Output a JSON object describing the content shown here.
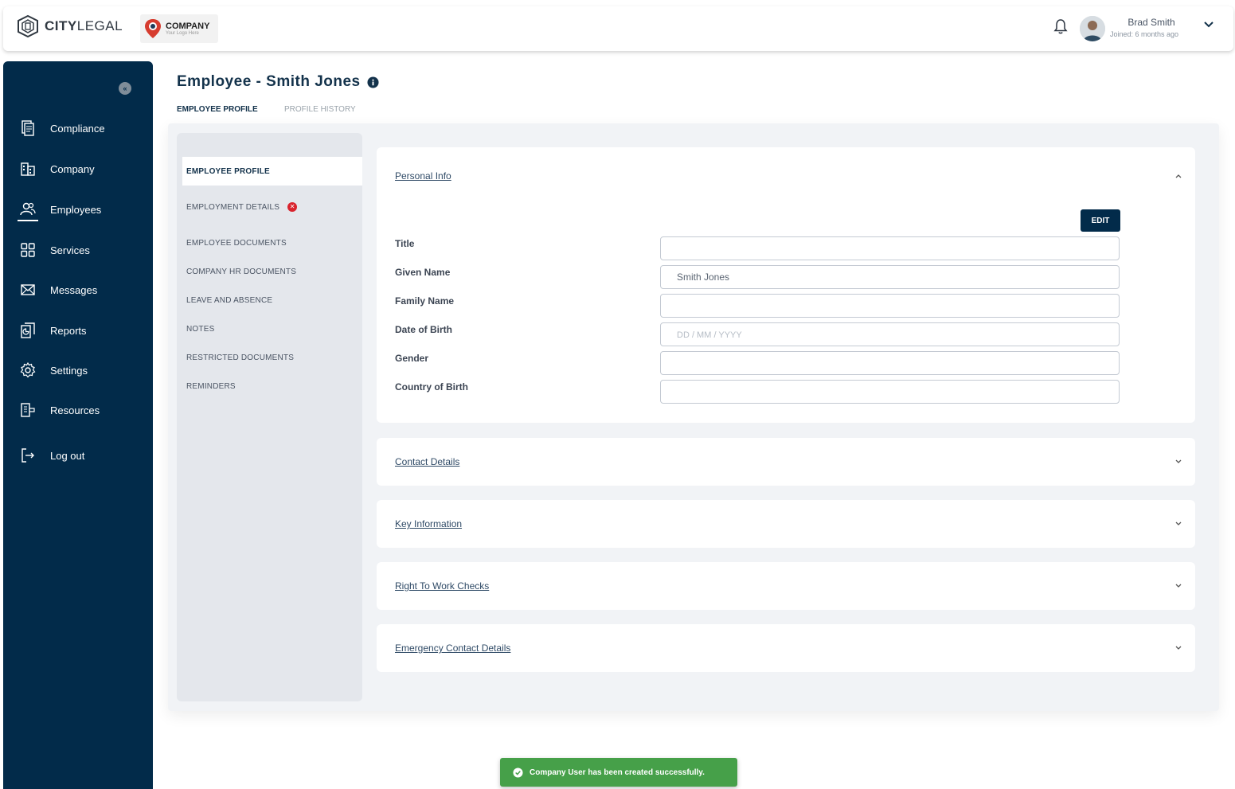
{
  "header": {
    "brand": {
      "bold": "CITY",
      "light": "LEGAL"
    },
    "company_logo": {
      "name": "COMPANY",
      "tagline": "Your Logo Here"
    },
    "user": {
      "name": "Brad Smith",
      "joined": "Joined: 6 months ago"
    }
  },
  "sidebar": {
    "collapse_label": "«",
    "items": [
      {
        "label": "Compliance",
        "icon": "compliance-icon"
      },
      {
        "label": "Company",
        "icon": "building-icon"
      },
      {
        "label": "Employees",
        "icon": "users-icon",
        "active": true
      },
      {
        "label": "Services",
        "icon": "grid-icon"
      },
      {
        "label": "Messages",
        "icon": "envelope-icon"
      },
      {
        "label": "Reports",
        "icon": "reports-icon"
      },
      {
        "label": "Settings",
        "icon": "gear-icon"
      },
      {
        "label": "Resources",
        "icon": "resources-icon"
      },
      {
        "label": "Log out",
        "icon": "logout-icon"
      }
    ]
  },
  "page": {
    "title": "Employee - Smith Jones",
    "tabs": [
      {
        "label": "EMPLOYEE PROFILE",
        "active": true
      },
      {
        "label": "PROFILE HISTORY",
        "active": false
      }
    ]
  },
  "subnav": {
    "items": [
      {
        "label": "EMPLOYEE PROFILE",
        "active": true
      },
      {
        "label": "EMPLOYMENT DETAILS",
        "error_badge": "✕"
      },
      {
        "label": "EMPLOYEE DOCUMENTS"
      },
      {
        "label": "COMPANY HR DOCUMENTS"
      },
      {
        "label": "LEAVE AND ABSENCE"
      },
      {
        "label": "NOTES"
      },
      {
        "label": "RESTRICTED DOCUMENTS"
      },
      {
        "label": "REMINDERS"
      }
    ]
  },
  "personal_info": {
    "title": "Personal Info",
    "edit_label": "EDIT",
    "fields": [
      {
        "label": "Title",
        "value": "",
        "placeholder": ""
      },
      {
        "label": "Given Name",
        "value": "Smith Jones",
        "placeholder": ""
      },
      {
        "label": "Family Name",
        "value": "",
        "placeholder": ""
      },
      {
        "label": "Date of Birth",
        "value": "",
        "placeholder": "DD / MM / YYYY"
      },
      {
        "label": "Gender",
        "value": "",
        "placeholder": ""
      },
      {
        "label": "Country of Birth",
        "value": "",
        "placeholder": ""
      }
    ]
  },
  "sections": [
    {
      "title": "Contact Details"
    },
    {
      "title": "Key Information"
    },
    {
      "title": "Right To Work Checks"
    },
    {
      "title": "Emergency Contact Details"
    }
  ],
  "toast": {
    "message": "Company User has been created successfully."
  },
  "colors": {
    "navy": "#022b4a",
    "success": "#46a049",
    "error": "#d9232d"
  }
}
